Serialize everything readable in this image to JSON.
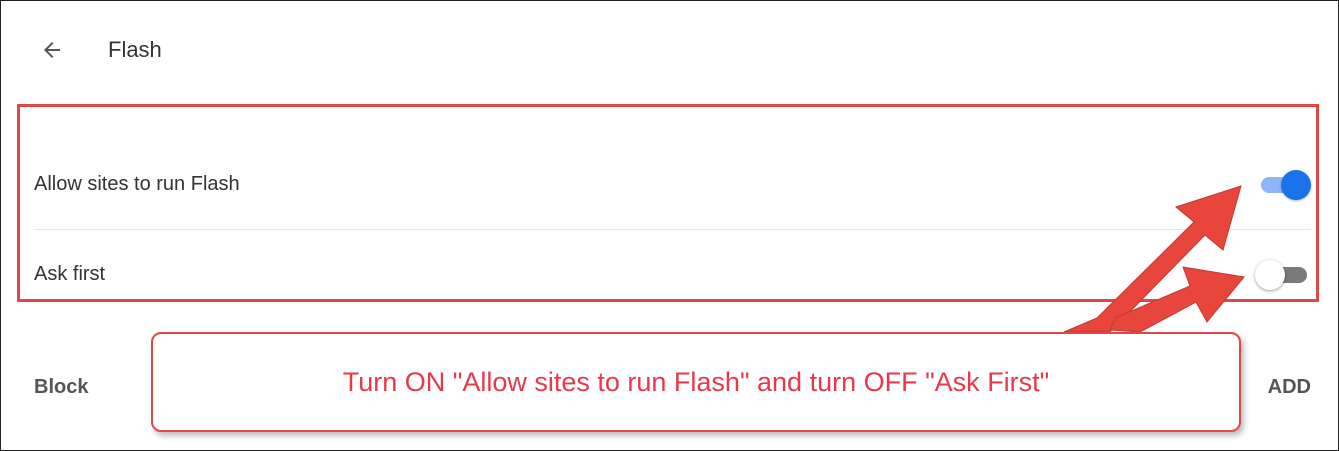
{
  "header": {
    "back_icon": "arrow-left-icon",
    "title": "Flash"
  },
  "settings": {
    "allow": {
      "label": "Allow sites to run Flash",
      "enabled": true
    },
    "ask": {
      "label": "Ask first",
      "enabled": false
    }
  },
  "block_section": {
    "label": "Block",
    "add_label": "ADD"
  },
  "annotation": {
    "text": "Turn ON \"Allow sites to run Flash\" and turn OFF \"Ask First\"",
    "color": "#e04848"
  },
  "colors": {
    "toggle_on_knob": "#1a73e8",
    "toggle_on_track": "#8fb4f7",
    "toggle_off_track": "#7a7a7a",
    "highlight": "#e04848"
  }
}
